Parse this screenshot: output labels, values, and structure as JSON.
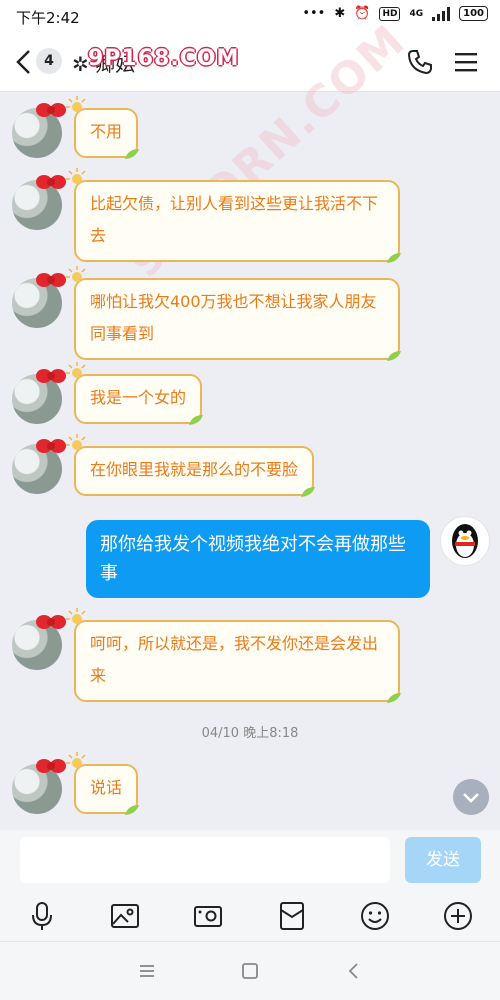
{
  "status_bar": {
    "time": "下午2:42",
    "network": "4G",
    "hd": "HD",
    "battery": "100"
  },
  "header": {
    "unread_count": "4",
    "contact_name": "✲ 卿妘",
    "watermark": "9P168.COM"
  },
  "watermark_diagonal": "91PORN.COM",
  "messages": [
    {
      "from": "other",
      "text": "不用"
    },
    {
      "from": "other",
      "text": "比起欠债，让别人看到这些更让我活不下去"
    },
    {
      "from": "other",
      "text": "哪怕让我欠400万我也不想让我家人朋友同事看到"
    },
    {
      "from": "other",
      "text": "我是一个女的"
    },
    {
      "from": "other",
      "text": "在你眼里我就是那么的不要脸"
    },
    {
      "from": "self",
      "text": "那你给我发个视频我绝对不会再做那些事"
    },
    {
      "from": "other",
      "text": "呵呵，所以就还是，我不发你还是会发出来"
    },
    {
      "from": "other",
      "text": "说话"
    }
  ],
  "timestamp": "04/10 晚上8:18",
  "input": {
    "placeholder": "",
    "send_label": "发送"
  },
  "icons": {
    "toolbar": [
      "microphone-icon",
      "image-icon",
      "camera-icon",
      "red-packet-icon",
      "emoji-icon",
      "plus-icon"
    ],
    "nav": [
      "menu-icon",
      "home-icon",
      "back-icon"
    ]
  },
  "colors": {
    "accent_blue": "#0e9bf4",
    "send_disabled": "#a6d6f7",
    "bubble_text_orange": "#ec7b19",
    "bubble_border": "#ebb65a",
    "chat_background": "#eceef3"
  }
}
